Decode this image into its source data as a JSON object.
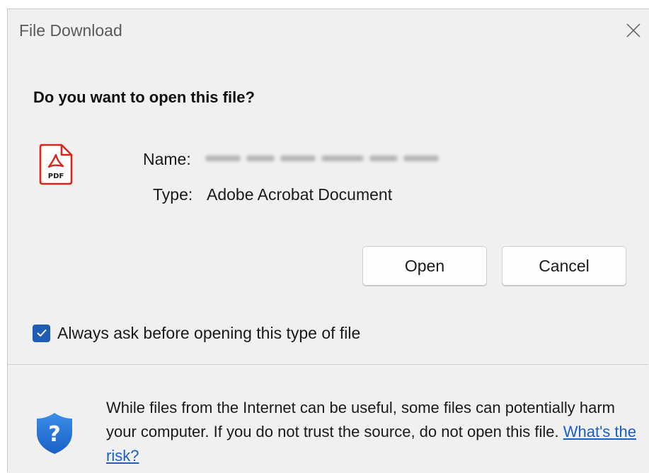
{
  "dialog": {
    "title": "File Download",
    "question": "Do you want to open this file?",
    "name_label": "Name:",
    "type_label": "Type:",
    "type_value": "Adobe Acrobat Document",
    "file_icon_text": "PDF",
    "open_button": "Open",
    "cancel_button": "Cancel",
    "checkbox_label": "Always ask before opening this type of file",
    "checkbox_checked": true,
    "warning_text": "While files from the Internet can be useful, some files can potentially harm your computer. If you do not trust the source, do not open this file.",
    "risk_link": "What's the risk?"
  },
  "icons": {
    "close": "close-icon",
    "file": "pdf-file-icon",
    "checkbox": "checkmark-icon",
    "shield": "shield-question-icon"
  },
  "colors": {
    "dialog_bg": "#f0f0f0",
    "accent": "#1f5db5",
    "pdf_red": "#d9261c",
    "link": "#1a5fc7"
  }
}
